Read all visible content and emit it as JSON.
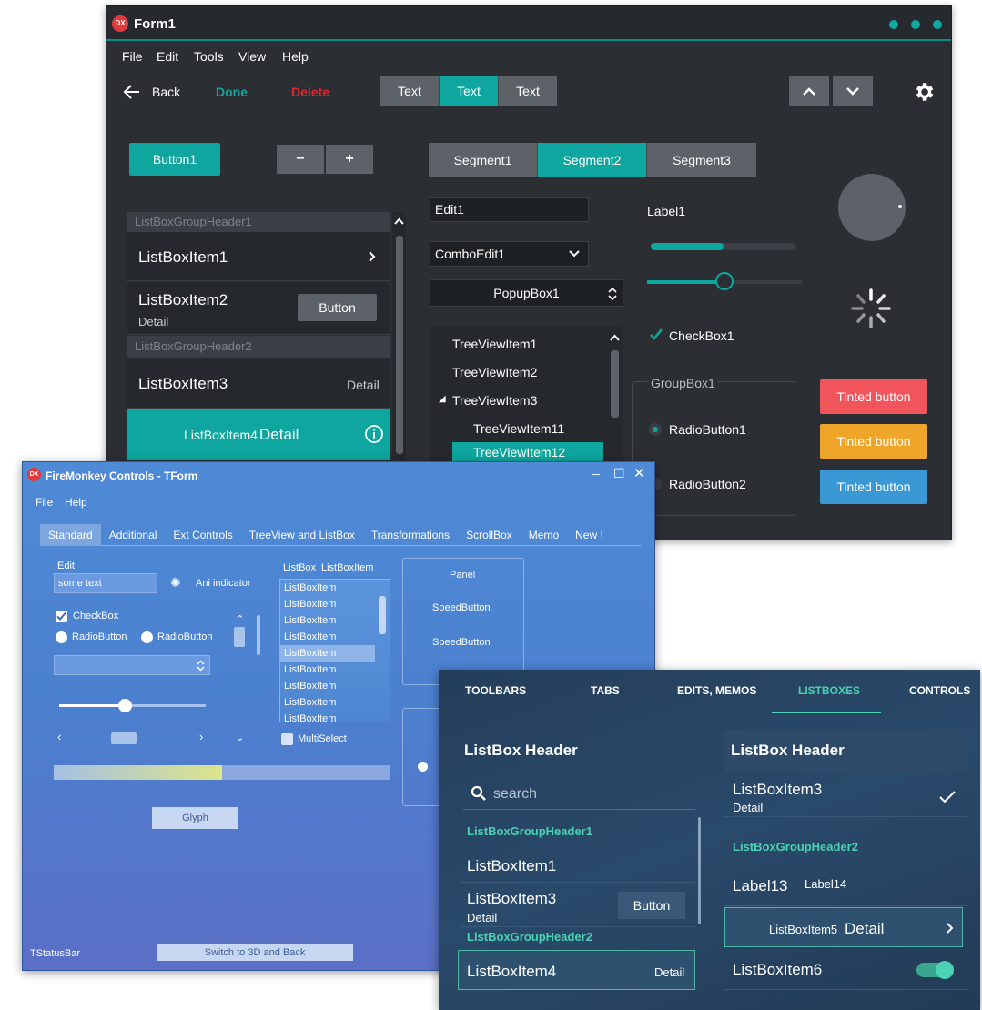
{
  "form1": {
    "title": "Form1",
    "menu": [
      "File",
      "Edit",
      "Tools",
      "View",
      "Help"
    ],
    "toolbar": {
      "back": "Back",
      "done": "Done",
      "delete": "Delete",
      "seg": [
        "Text",
        "Text",
        "Text"
      ]
    },
    "button1": "Button1",
    "minus": "−",
    "plus": "+",
    "segments": [
      "Segment1",
      "Segment2",
      "Segment3"
    ],
    "listbox": {
      "gh1": "ListBoxGroupHeader1",
      "item1": "ListBoxItem1",
      "item2": "ListBoxItem2",
      "item2_detail": "Detail",
      "item2_btn": "Button",
      "gh2": "ListBoxGroupHeader2",
      "item3": "ListBoxItem3",
      "item3_detail": "Detail",
      "item4": "ListBoxItem4",
      "item4_detail": "Detail"
    },
    "edit1": "Edit1",
    "comboedit1": "ComboEdit1",
    "popupbox1": "PopupBox1",
    "tree": [
      "TreeViewItem1",
      "TreeViewItem2",
      "TreeViewItem3",
      "TreeViewItem11",
      "TreeViewItem12"
    ],
    "label1": "Label1",
    "progress_fraction": 0.5,
    "trackbar_fraction": 0.5,
    "checkbox1": "CheckBox1",
    "groupbox1": "GroupBox1",
    "radio1": "RadioButton1",
    "radio2": "RadioButton2",
    "tinted": [
      "Tinted button",
      "Tinted button",
      "Tinted button"
    ],
    "colors": {
      "accent": "#0ea69e",
      "red": "#f2545b",
      "orange": "#efa529",
      "blue": "#3a98d4",
      "delete": "#e0252b"
    }
  },
  "fmx": {
    "title": "FireMonkey Controls - TForm",
    "menu": [
      "File",
      "Help"
    ],
    "tabs": [
      "Standard",
      "Additional",
      "Ext Controls",
      "TreeView and ListBox",
      "Transformations",
      "ScrollBox",
      "Memo",
      "New !"
    ],
    "edit_label": "Edit",
    "edit_value": "some text",
    "ani": "Ani indicator",
    "checkbox": "CheckBox",
    "radio1": "RadioButton",
    "radio2": "RadioButton",
    "listbox_label": "ListBox",
    "listitem_label": "ListBoxItem",
    "listitems": [
      "ListBoxItem",
      "ListBoxItem",
      "ListBoxItem",
      "ListBoxItem",
      "ListBoxItem",
      "ListBoxItem",
      "ListBoxItem",
      "ListBoxItem",
      "ListBoxItem"
    ],
    "panel": "Panel",
    "speed1": "SpeedButton",
    "speed2": "SpeedButton",
    "multiselect": "MultiSelect",
    "glyph": "Glyph",
    "statusbar": "TStatusBar",
    "switch3d": "Switch to 3D and Back",
    "trackbar_fraction": 0.45,
    "progress_fraction": 0.5
  },
  "dark": {
    "tabs": [
      "TOOLBARS",
      "TABS",
      "EDITS, MEMOS",
      "LISTBOXES",
      "CONTROLS"
    ],
    "left": {
      "header": "ListBox Header",
      "search": "search",
      "gh1": "ListBoxGroupHeader1",
      "item1": "ListBoxItem1",
      "item3": "ListBoxItem3",
      "item3_detail": "Detail",
      "button": "Button",
      "gh2": "ListBoxGroupHeader2",
      "item4": "ListBoxItem4",
      "item4_detail": "Detail"
    },
    "right": {
      "header": "ListBox Header",
      "item3": "ListBoxItem3",
      "item3_detail": "Detail",
      "gh2": "ListBoxGroupHeader2",
      "label13": "Label13",
      "label14": "Label14",
      "item5": "ListBoxItem5",
      "item5_detail": "Detail",
      "item6": "ListBoxItem6"
    },
    "colors": {
      "accent": "#4bd1b3"
    }
  }
}
